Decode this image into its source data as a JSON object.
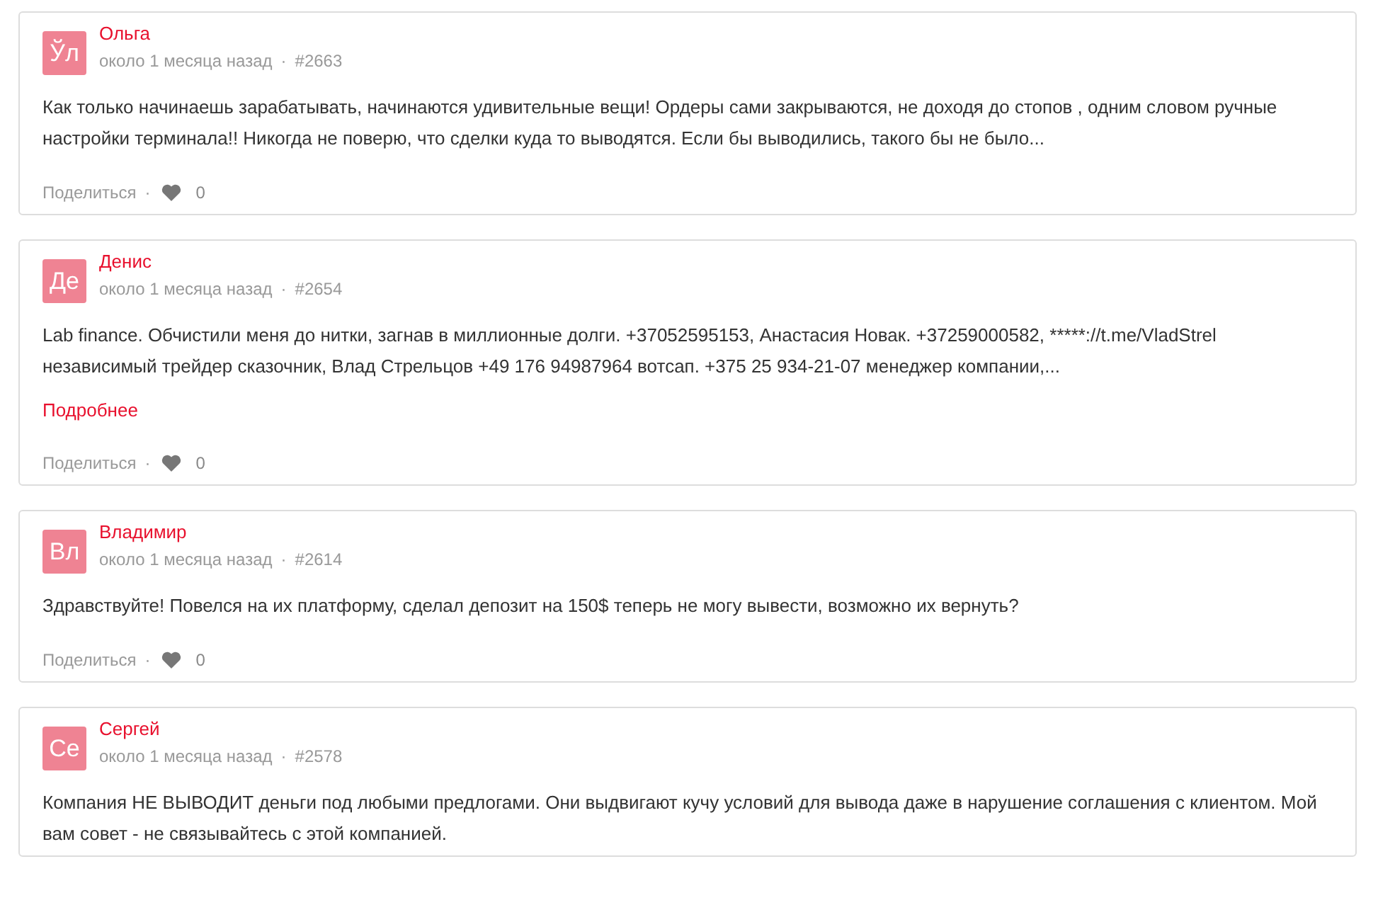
{
  "separator": "·",
  "posts": [
    {
      "avatar": "Ўл",
      "author": "Ольга",
      "time": "около 1 месяца назад",
      "number": "#2663",
      "text": "Как только начинаешь зарабатывать, начинаются удивительные вещи! Ордеры сами закрываются, не доходя до стопов , одним словом ручные настройки терминала!! Никогда не поверю, что сделки куда то выводятся. Если бы выводились, такого бы не было...",
      "footer": {
        "share": "Поделиться",
        "likes": "0"
      }
    },
    {
      "avatar": "Де",
      "author": "Денис",
      "time": "около 1 месяца назад",
      "number": "#2654",
      "text": "Lab finance. Обчистили меня до нитки, загнав в миллионные долги. +37052595153, Анастасия Новак. +37259000582, *****://t.me/VladStrel независимый трейдер сказочник, Влад Стрельцов +49 176 94987964 вотсап. +375 25 934-21-07 менеджер компании,...",
      "more": "Подробнее",
      "footer": {
        "share": "Поделиться",
        "likes": "0"
      }
    },
    {
      "avatar": "Вл",
      "author": "Владимир",
      "time": "около 1 месяца назад",
      "number": "#2614",
      "text": "Здравствуйте! Повелся на их платформу, сделал депозит на 150$ теперь не могу вывести, возможно их вернуть?",
      "footer": {
        "share": "Поделиться",
        "likes": "0"
      }
    },
    {
      "avatar": "Се",
      "author": "Сергей",
      "time": "около 1 месяца назад",
      "number": "#2578",
      "text": "Компания НЕ ВЫВОДИТ деньги под любыми предлогами. Они выдвигают кучу условий для вывода даже в нарушение соглашения с клиентом. Мой вам совет - не связывайтесь с этой компанией."
    }
  ]
}
